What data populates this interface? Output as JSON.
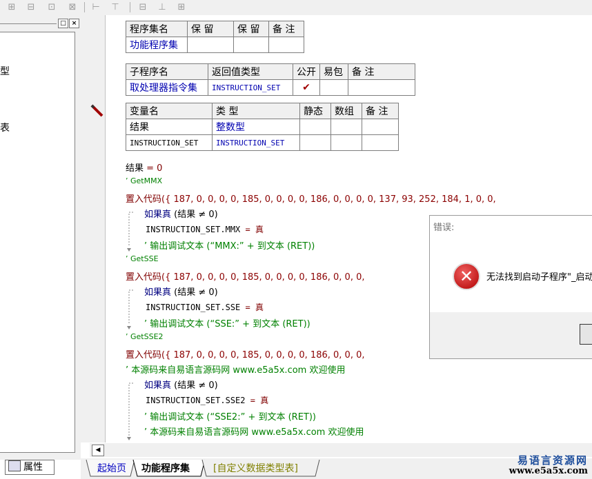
{
  "toolbar": {
    "buttons": [
      "⊞",
      "⊟",
      "⊡",
      "⊠",
      "⊢",
      "⊤",
      "⊟",
      "⊥",
      "⊞"
    ]
  },
  "left_panel": {
    "title_buttons": [
      "□",
      "×"
    ],
    "items": [
      "型",
      "表"
    ],
    "property_tab": "属性"
  },
  "assembly_table": {
    "headers": [
      "程序集名",
      "保 留",
      "保 留",
      "备 注"
    ],
    "row": [
      "功能程序集",
      "",
      "",
      ""
    ]
  },
  "sub_table": {
    "headers": [
      "子程序名",
      "返回值类型",
      "公开",
      "易包",
      "备 注"
    ],
    "row": [
      "取处理器指令集",
      "INSTRUCTION_SET",
      "✔",
      "",
      ""
    ]
  },
  "var_table": {
    "headers": [
      "变量名",
      "类 型",
      "静态",
      "数组",
      "备 注"
    ],
    "rows": [
      [
        "结果",
        "整数型",
        "",
        "",
        ""
      ],
      [
        "INSTRUCTION_SET",
        "INSTRUCTION_SET",
        "",
        "",
        ""
      ]
    ]
  },
  "code_lines": {
    "l1_a": "结果",
    "l1_b": " = 0",
    "l2": "’ GetMMX",
    "l3_a": "置入代码",
    "l3_b": "({ 187, 0, 0, 0, 0, 185, 0, 0, 0, 0, 186, 0, 0, 0, 0, 137, 93, 252, 184, 1, 0, 0,",
    "l4_a": "如果真",
    "l4_b": "(结果 ≠ 0)",
    "l5_a": "INSTRUCTION_SET.MMX",
    "l5_b": " = ",
    "l5_c": "真",
    "l6": "’ 输出调试文本 (“MMX:” + 到文本 (RET))",
    "l7": "’ GetSSE",
    "l8_a": "置入代码",
    "l8_b": "({ 187, 0, 0, 0, 0, 185, 0, 0, 0, 0, 186, 0, 0, 0,",
    "l9_a": "如果真",
    "l9_b": "(结果 ≠ 0)",
    "l10_a": "INSTRUCTION_SET.SSE",
    "l10_b": " = ",
    "l10_c": "真",
    "l11": "’ 输出调试文本 (“SSE:” + 到文本 (RET))",
    "l12": "’ GetSSE2",
    "l13_a": "置入代码",
    "l13_b": "({ 187, 0, 0, 0, 0, 185, 0, 0, 0, 0, 186, 0, 0, 0,",
    "l14": "’ 本源码来自易语言源码网 www.e5a5x.com  欢迎使用",
    "l15_a": "如果真",
    "l15_b": "(结果 ≠ 0)",
    "l16_a": "INSTRUCTION_SET.SSE2",
    "l16_b": " = ",
    "l16_c": "真",
    "l17": "’ 输出调试文本 (“SSE2:” + 到文本 (RET))",
    "l18": "’ 本源码来自易语言源码网 www.e5a5x.com  欢迎使用"
  },
  "tabs": {
    "start": "起始页",
    "active": "功能程序集",
    "custom": "[自定义数据类型表]"
  },
  "dialog": {
    "title": "错误:",
    "message": "无法找到启动子程序\"_启动"
  },
  "watermark": {
    "top": "易语言资源网",
    "bottom": "www.e5a5x.com"
  },
  "colors": {
    "keyword": "#800000",
    "comment": "#008000",
    "type": "#0000b0",
    "active_tab": "#000000",
    "custom_tab": "#808000"
  }
}
